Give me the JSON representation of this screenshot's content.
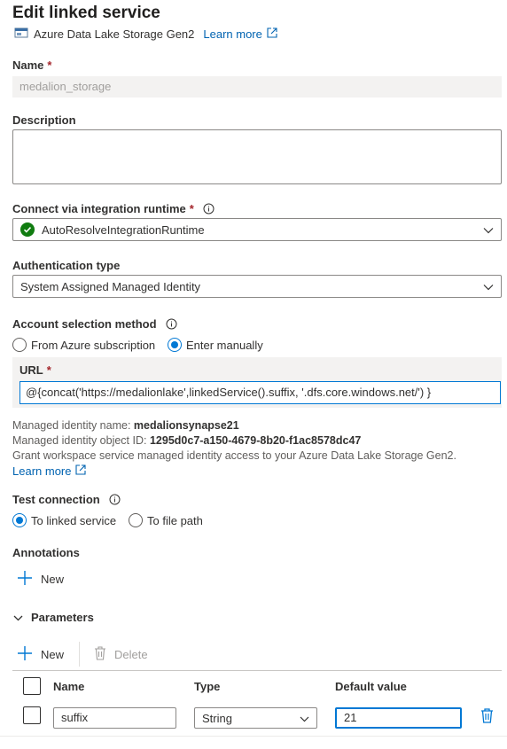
{
  "header": {
    "title": "Edit linked service",
    "service_type": "Azure Data Lake Storage Gen2",
    "learn_more": "Learn more"
  },
  "name": {
    "label": "Name",
    "required": "*",
    "value": "medalion_storage"
  },
  "description": {
    "label": "Description",
    "value": ""
  },
  "runtime": {
    "label": "Connect via integration runtime",
    "required": "*",
    "value": "AutoResolveIntegrationRuntime"
  },
  "auth": {
    "label": "Authentication type",
    "value": "System Assigned Managed Identity"
  },
  "account": {
    "label": "Account selection method",
    "options": [
      "From Azure subscription",
      "Enter manually"
    ],
    "selected": "Enter manually"
  },
  "url": {
    "label": "URL",
    "required": "*",
    "value": "@{concat('https://medalionlake',linkedService().suffix, '.dfs.core.windows.net/') }"
  },
  "identity": {
    "name_label": "Managed identity name:",
    "name_value": "medalionsynapse21",
    "id_label": "Managed identity object ID:",
    "id_value": "1295d0c7-a150-4679-8b20-f1ac8578dc47",
    "grant_text": "Grant workspace service managed identity access to your Azure Data Lake Storage Gen2.",
    "learn_more": "Learn more"
  },
  "test_connection": {
    "label": "Test connection",
    "options": [
      "To linked service",
      "To file path"
    ],
    "selected": "To linked service"
  },
  "annotations": {
    "label": "Annotations",
    "new_label": "New"
  },
  "parameters": {
    "label": "Parameters",
    "new_label": "New",
    "delete_label": "Delete",
    "columns": [
      "Name",
      "Type",
      "Default value"
    ],
    "rows": [
      {
        "name": "suffix",
        "type": "String",
        "default": "21"
      }
    ]
  },
  "colors": {
    "accent": "#0078d4",
    "link": "#0063b1",
    "success": "#107c10",
    "required": "#a4262c"
  }
}
